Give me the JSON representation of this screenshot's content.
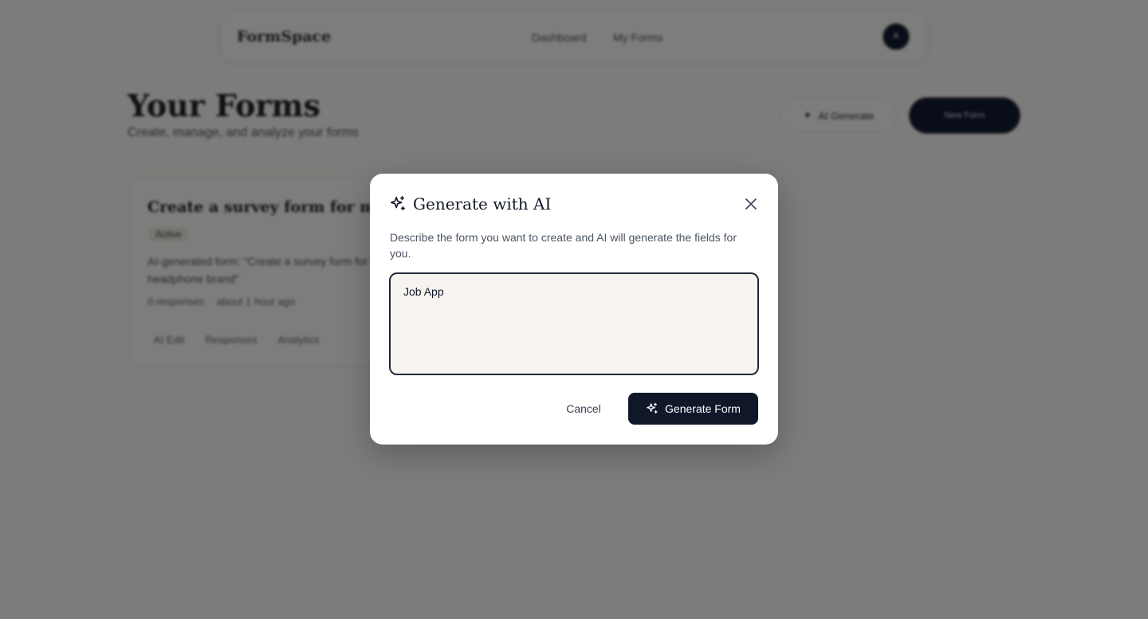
{
  "nav": {
    "brand": "FormSpace",
    "links": [
      "Dashboard",
      "My Forms"
    ],
    "avatar_initial": "A"
  },
  "header": {
    "title": "Your Forms",
    "subtitle": "Create, manage, and analyze your forms",
    "ai_generate_label": "AI Generate",
    "new_form_label": "New Form"
  },
  "card": {
    "title": "Create a survey form for my fo...",
    "status": "Active",
    "description": "AI-generated form: \"Create a survey form for my headphone brand\"",
    "responses": "0 responses",
    "updated": "about 1 hour ago",
    "actions": [
      "AI Edit",
      "Responses",
      "Analytics"
    ]
  },
  "modal": {
    "title": "Generate with AI",
    "description": "Describe the form you want to create and AI will generate the fields for you.",
    "input_value": "Job App",
    "cancel_label": "Cancel",
    "generate_label": "Generate Form"
  },
  "colors": {
    "primary": "#0f1729",
    "input_bg": "#f7f4ef",
    "page_bg": "#faf8f5"
  }
}
